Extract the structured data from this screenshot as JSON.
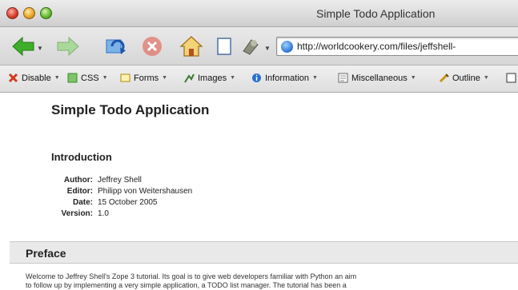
{
  "window": {
    "title": "Simple Todo Application"
  },
  "navigation": {
    "back_icon": "back-arrow-icon",
    "forward_icon": "forward-arrow-icon",
    "reload_icon": "reload-icon",
    "stop_icon": "stop-icon",
    "home_icon": "home-icon",
    "bookmark_icon": "bookmark-page-icon",
    "tools_icon": "tools-icon",
    "url": "http://worldcookery.com/files/jeffshell-"
  },
  "devtoolbar": {
    "items": [
      {
        "label": "Disable",
        "icon": "disable-icon"
      },
      {
        "label": "CSS",
        "icon": "css-icon"
      },
      {
        "label": "Forms",
        "icon": "forms-icon"
      },
      {
        "label": "Images",
        "icon": "images-icon"
      },
      {
        "label": "Information",
        "icon": "information-icon"
      },
      {
        "label": "Miscellaneous",
        "icon": "miscellaneous-icon"
      },
      {
        "label": "Outline",
        "icon": "outline-icon"
      }
    ]
  },
  "document": {
    "title": "Simple Todo Application",
    "introduction_heading": "Introduction",
    "meta": [
      {
        "label": "Author:",
        "value": "Jeffrey Shell"
      },
      {
        "label": "Editor:",
        "value": "Philipp von Weitershausen"
      },
      {
        "label": "Date:",
        "value": "15 October 2005"
      },
      {
        "label": "Version:",
        "value": "1.0"
      }
    ],
    "preface_heading": "Preface",
    "preface_text_1": "Welcome to Jeffrey Shell's Zope 3 tutorial. Its goal is to give web developers familiar with Python an aim",
    "preface_text_2": "to follow up by implementing a very simple application, a TODO list manager. The tutorial has been a"
  },
  "colors": {
    "accent_blue": "#2a6fd1",
    "back_green": "#3fae2a",
    "stop_red": "#e2513f"
  }
}
